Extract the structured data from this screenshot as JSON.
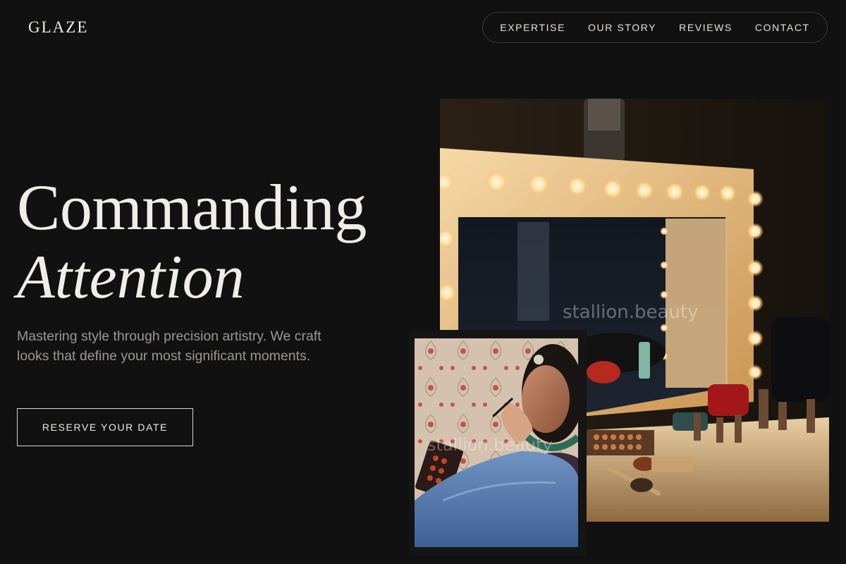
{
  "brand": {
    "logo": "GLAZE"
  },
  "nav": {
    "items": [
      "EXPERTISE",
      "OUR STORY",
      "REVIEWS",
      "CONTACT"
    ]
  },
  "hero": {
    "headline_line1": "Commanding",
    "headline_line2": "Attention",
    "subtext": "Mastering style through precision artistry. We craft looks that define your most significant moments.",
    "cta_label": "RESERVE YOUR DATE"
  },
  "images": {
    "main_watermark": "stallion.beauty",
    "small_watermark": "stallion.beauty"
  },
  "colors": {
    "background": "#111111",
    "text": "#e8e6e1",
    "muted_text": "#9a9893"
  }
}
